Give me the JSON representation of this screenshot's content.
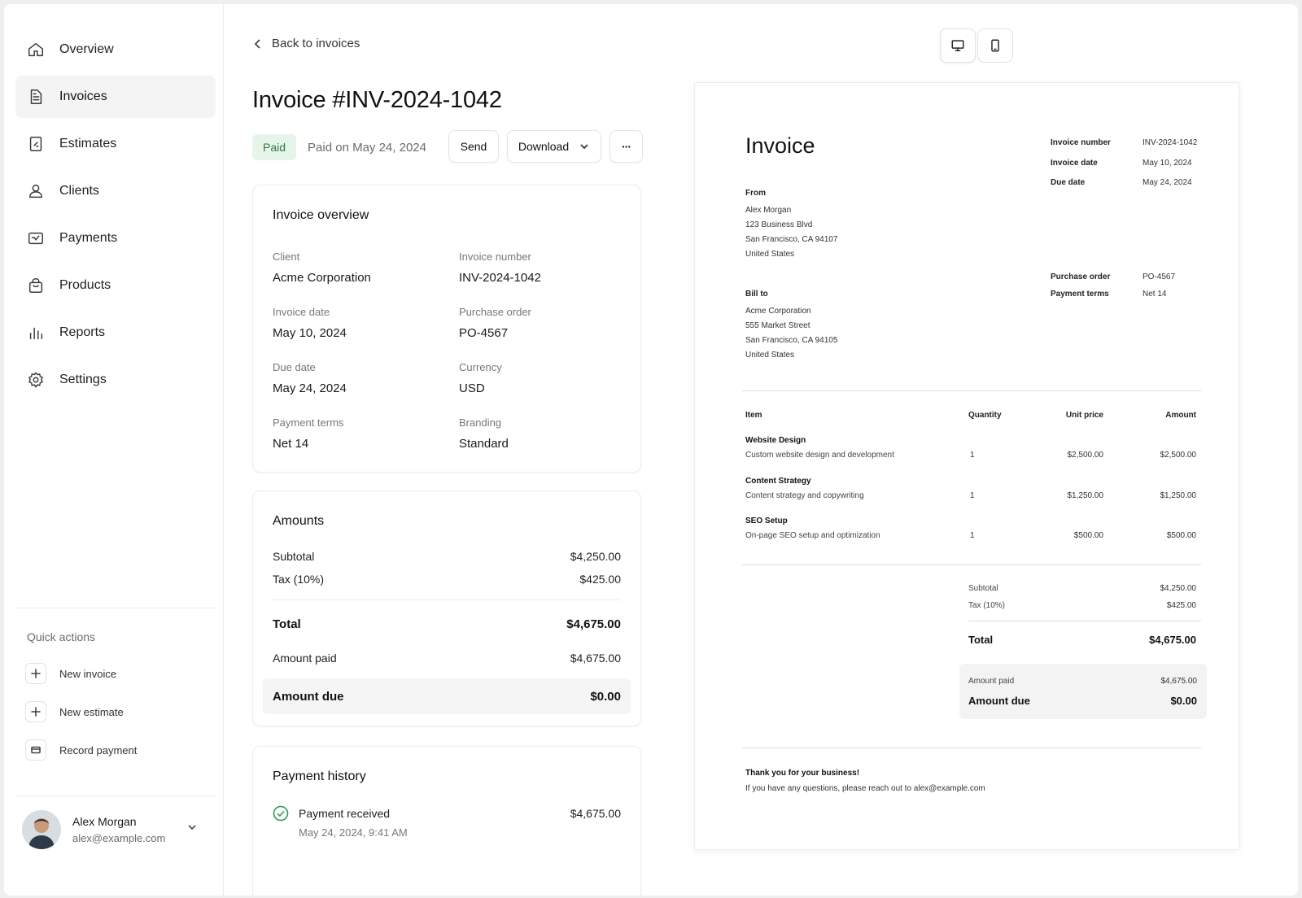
{
  "sidebar": {
    "items": [
      {
        "label": "Overview",
        "icon": "home-icon"
      },
      {
        "label": "Invoices",
        "icon": "document-icon",
        "active": true
      },
      {
        "label": "Estimates",
        "icon": "estimate-icon"
      },
      {
        "label": "Clients",
        "icon": "user-icon"
      },
      {
        "label": "Payments",
        "icon": "payment-icon"
      },
      {
        "label": "Products",
        "icon": "bag-icon"
      },
      {
        "label": "Reports",
        "icon": "bar-chart-icon"
      },
      {
        "label": "Settings",
        "icon": "gear-icon"
      }
    ],
    "quick_actions_title": "Quick actions",
    "quick_actions": [
      {
        "label": "New invoice",
        "icon": "plus-icon"
      },
      {
        "label": "New estimate",
        "icon": "plus-icon"
      },
      {
        "label": "Record payment",
        "icon": "card-icon"
      }
    ],
    "profile": {
      "name": "Alex Morgan",
      "email": "alex@example.com"
    }
  },
  "header": {
    "back_label": "Back to invoices",
    "title": "Invoice #INV-2024-1042",
    "status_badge": "Paid",
    "paid_on": "Paid on May 24, 2024",
    "send_label": "Send",
    "download_label": "Download",
    "more_label": "···"
  },
  "overview": {
    "title": "Invoice overview",
    "fields": [
      {
        "label": "Client",
        "value": "Acme Corporation"
      },
      {
        "label": "Invoice number",
        "value": "INV-2024-1042"
      },
      {
        "label": "Invoice date",
        "value": "May 10, 2024"
      },
      {
        "label": "Purchase order",
        "value": "PO-4567"
      },
      {
        "label": "Due date",
        "value": "May 24, 2024"
      },
      {
        "label": "Currency",
        "value": "USD"
      },
      {
        "label": "Payment terms",
        "value": "Net 14"
      },
      {
        "label": "Branding",
        "value": "Standard"
      }
    ]
  },
  "amounts": {
    "title": "Amounts",
    "subtotal_label": "Subtotal",
    "subtotal": "$4,250.00",
    "tax_label": "Tax (10%)",
    "tax": "$425.00",
    "total_label": "Total",
    "total": "$4,675.00",
    "paid_label": "Amount paid",
    "paid": "$4,675.00",
    "due_label": "Amount due",
    "due": "$0.00"
  },
  "payment_history": {
    "title": "Payment history",
    "entries": [
      {
        "label": "Payment received",
        "time": "May 24, 2024, 9:41 AM",
        "amount": "$4,675.00"
      }
    ]
  },
  "preview": {
    "title": "Invoice",
    "meta": [
      {
        "label": "Invoice number",
        "value": "INV-2024-1042"
      },
      {
        "label": "Invoice date",
        "value": "May 10, 2024"
      },
      {
        "label": "Due date",
        "value": "May 24, 2024"
      },
      {
        "label": "Purchase order",
        "value": "PO-4567"
      },
      {
        "label": "Payment terms",
        "value": "Net 14"
      }
    ],
    "from_label": "From",
    "from": [
      "Alex Morgan",
      "123 Business Blvd",
      "San Francisco, CA 94107",
      "United States"
    ],
    "bill_to_label": "Bill to",
    "bill_to": [
      "Acme Corporation",
      "555 Market Street",
      "San Francisco, CA 94105",
      "United States"
    ],
    "columns": [
      "Item",
      "Quantity",
      "Unit price",
      "Amount"
    ],
    "items": [
      {
        "name": "Website Design",
        "desc": "Custom website design and development",
        "qty": "1",
        "unit": "$2,500.00",
        "amount": "$2,500.00"
      },
      {
        "name": "Content Strategy",
        "desc": "Content strategy and copywriting",
        "qty": "1",
        "unit": "$1,250.00",
        "amount": "$1,250.00"
      },
      {
        "name": "SEO Setup",
        "desc": "On-page SEO setup and optimization",
        "qty": "1",
        "unit": "$500.00",
        "amount": "$500.00"
      }
    ],
    "subtotal_label": "Subtotal",
    "subtotal": "$4,250.00",
    "tax_label": "Tax (10%)",
    "tax": "$425.00",
    "total_label": "Total",
    "total": "$4,675.00",
    "paid_label": "Amount paid",
    "paid": "$4,675.00",
    "due_label": "Amount due",
    "due": "$0.00",
    "thanks": "Thank you for your business!",
    "contact": "If you have any questions, please reach out to alex@example.com"
  },
  "device_toggle": {
    "active": "desktop",
    "options": [
      "desktop-icon",
      "mobile-icon"
    ]
  },
  "colors": {
    "paid_badge_bg": "#e6f4ea",
    "paid_badge_text": "#2e7d43",
    "success_check": "#2e9a50"
  }
}
